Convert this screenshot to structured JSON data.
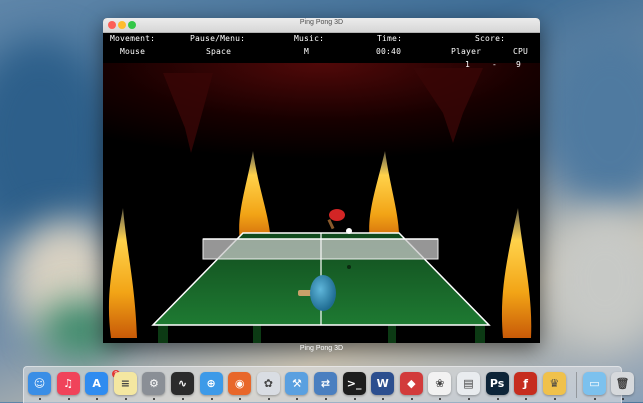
{
  "window": {
    "title": "Ping Pong 3D",
    "caption": "Ping Pong 3D"
  },
  "hud": {
    "movement_label": "Movement:",
    "movement_value": "Mouse",
    "pause_label": "Pause/Menu:",
    "pause_value": "Space",
    "music_label": "Music:",
    "music_value": "M",
    "time_label": "Time:",
    "time_value": "00:40",
    "score_label": "Score:",
    "player_label": "Player",
    "cpu_label": "CPU",
    "player_score": "1",
    "separator": "-",
    "cpu_score": "9"
  },
  "dock": {
    "app_store_badge": "9",
    "items": [
      {
        "name": "finder-icon",
        "color": "#3a8ee6",
        "glyph": "☺"
      },
      {
        "name": "itunes-icon",
        "color": "#f0435a",
        "glyph": "♫"
      },
      {
        "name": "app-store-icon",
        "color": "#2f8cf0",
        "glyph": "A"
      },
      {
        "name": "notes-icon",
        "color": "#f4e7a1",
        "glyph": "≡"
      },
      {
        "name": "system-preferences-icon",
        "color": "#8a8f96",
        "glyph": "⚙"
      },
      {
        "name": "activity-monitor-icon",
        "color": "#2b2b2b",
        "glyph": "∿"
      },
      {
        "name": "safari-icon",
        "color": "#3d9ae8",
        "glyph": "⊕"
      },
      {
        "name": "firefox-icon",
        "color": "#e8672a",
        "glyph": "◉"
      },
      {
        "name": "photo-app-icon",
        "color": "#d9dde3",
        "glyph": "✿"
      },
      {
        "name": "xcode-icon",
        "color": "#5aa0e0",
        "glyph": "⚒"
      },
      {
        "name": "network-utility-icon",
        "color": "#4a7fc0",
        "glyph": "⇄"
      },
      {
        "name": "terminal-icon",
        "color": "#1d1d1d",
        "glyph": ">_"
      },
      {
        "name": "workspace-app-icon",
        "color": "#2c4f8f",
        "glyph": "W"
      },
      {
        "name": "game-app-icon",
        "color": "#d23b3b",
        "glyph": "◆"
      },
      {
        "name": "photos-icon",
        "color": "#f2f2f2",
        "glyph": "❀"
      },
      {
        "name": "preview-icon",
        "color": "#e9ecef",
        "glyph": "▤"
      },
      {
        "name": "photoshop-icon",
        "color": "#0d2438",
        "glyph": "Ps"
      },
      {
        "name": "flash-icon",
        "color": "#c62d1f",
        "glyph": "ƒ"
      },
      {
        "name": "clipboard-app-icon",
        "color": "#f0c14b",
        "glyph": "♛"
      }
    ],
    "folder": {
      "name": "folder-icon",
      "color": "#7cc1ee",
      "glyph": "▭"
    },
    "trash": {
      "name": "trash-icon",
      "color": "#d6d9dc",
      "glyph": "🗑"
    }
  }
}
